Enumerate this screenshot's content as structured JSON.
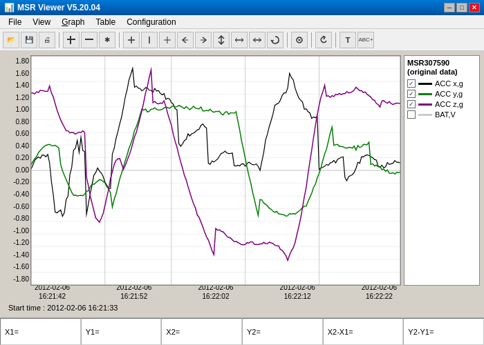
{
  "titleBar": {
    "title": "MSR Viewer V5.20.04",
    "icon": "📊",
    "controls": [
      "minimize",
      "maximize",
      "close"
    ]
  },
  "menuBar": {
    "items": [
      "File",
      "View",
      "Graph",
      "Table",
      "Configuration"
    ]
  },
  "toolbar": {
    "groups": [
      [
        "open",
        "save",
        "print"
      ],
      [
        "zoom-in",
        "zoom-out",
        "select"
      ],
      [
        "cursor-h",
        "cursor-v",
        "cursor-both",
        "cursor-left",
        "cursor-right",
        "cursor-center",
        "split",
        "merge",
        "reset"
      ],
      [
        "origin"
      ],
      [
        "undo"
      ],
      [
        "text",
        "abc-plus"
      ]
    ]
  },
  "graph": {
    "title": "MSR307590\n(original data)",
    "yAxisLabels": [
      "1.80",
      "1.60",
      "1.40",
      "1.20",
      "1.00",
      "0.80",
      "0.60",
      "0.40",
      "0.20",
      "0.00",
      "-0.20",
      "-0.40",
      "-0.60",
      "-0.80",
      "-1.00",
      "-1.20",
      "-1.40",
      "-1.60",
      "-1.80"
    ],
    "xAxisLabels": [
      {
        "date": "2012-02-06",
        "time": "16:21:42"
      },
      {
        "date": "2012-02-06",
        "time": "16:21:52"
      },
      {
        "date": "2012-02-06",
        "time": "16:22:02"
      },
      {
        "date": "2012-02-06",
        "time": "16:22:12"
      },
      {
        "date": "2012-02-06",
        "time": "16:22:22"
      }
    ],
    "startTime": "Start time : 2012-02-06 16:21:33",
    "legend": {
      "title": "MSR307590\n(original data)",
      "items": [
        {
          "label": "ACC x,g",
          "color": "#000000",
          "checked": true
        },
        {
          "label": "ACC y,g",
          "color": "#008000",
          "checked": true
        },
        {
          "label": "ACC z,g",
          "color": "#800080",
          "checked": true
        },
        {
          "label": "BAT,V",
          "color": "#cccccc",
          "checked": false
        }
      ]
    },
    "gridLines": 5,
    "verticalLines": 4
  },
  "statusBar": {
    "cells": [
      {
        "label": "X1=",
        "value": ""
      },
      {
        "label": "Y1=",
        "value": ""
      },
      {
        "label": "X2=",
        "value": ""
      },
      {
        "label": "Y2=",
        "value": ""
      },
      {
        "label": "X2-X1=",
        "value": ""
      },
      {
        "label": "Y2-Y1=",
        "value": ""
      }
    ]
  }
}
